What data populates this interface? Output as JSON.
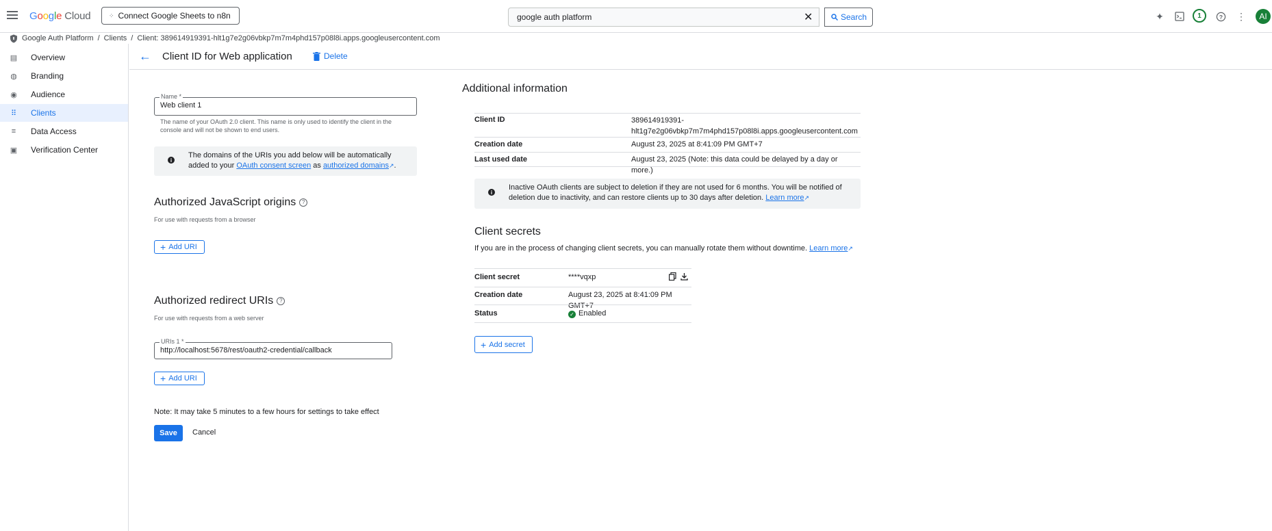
{
  "topbar": {
    "logo_google": "Google",
    "logo_cloud": "Cloud",
    "project": "Connect Google Sheets to n8n",
    "search_value": "google auth platform",
    "search_button": "Search",
    "notification_count": "1",
    "avatar_initials": "AI"
  },
  "breadcrumb": {
    "items": [
      "Google Auth Platform",
      "Clients",
      "Client: 389614919391-hlt1g7e2g06vbkp7m7m4phd157p08l8i.apps.googleusercontent.com"
    ],
    "separator": "/"
  },
  "sidebar": {
    "items": [
      {
        "label": "Overview"
      },
      {
        "label": "Branding"
      },
      {
        "label": "Audience"
      },
      {
        "label": "Clients"
      },
      {
        "label": "Data Access"
      },
      {
        "label": "Verification Center"
      }
    ]
  },
  "header": {
    "title": "Client ID for Web application",
    "delete_label": "Delete"
  },
  "form": {
    "name_label": "Name *",
    "name_value": "Web client 1",
    "name_hint": "The name of your OAuth 2.0 client. This name is only used to identify the client in the console and will not be shown to end users.",
    "info_text_before": "The domains of the URIs you add below will be automatically added to your",
    "info_link1": "OAuth consent screen",
    "info_mid": "as",
    "info_link2": "authorized domains",
    "info_end": ".",
    "js_title": "Authorized JavaScript origins",
    "js_sub": "For use with requests from a browser",
    "add_uri": "Add URI",
    "redirect_title": "Authorized redirect URIs",
    "redirect_sub": "For use with requests from a web server",
    "uri_label": "URIs 1 *",
    "uri_value": "http://localhost:5678/rest/oauth2-credential/callback",
    "note": "Note: It may take 5 minutes to a few hours for settings to take effect",
    "save": "Save",
    "cancel": "Cancel"
  },
  "additional": {
    "title": "Additional information",
    "rows": [
      {
        "key": "Client ID",
        "value_line1": "389614919391-",
        "value_line2": "hlt1g7e2g06vbkp7m7m4phd157p08l8i.apps.googleusercontent.com"
      },
      {
        "key": "Creation date",
        "value": "August 23, 2025 at 8:41:09 PM GMT+7"
      },
      {
        "key": "Last used date",
        "value": "August 23, 2025 (Note: this data could be delayed by a day or more.)"
      }
    ],
    "inactive_text": "Inactive OAuth clients are subject to deletion if they are not used for 6 months. You will be notified of deletion due to inactivity, and can restore clients up to 30 days after deletion.",
    "learn_more": "Learn more"
  },
  "secrets": {
    "title": "Client secrets",
    "desc": "If you are in the process of changing client secrets, you can manually rotate them without downtime.",
    "learn_more": "Learn more",
    "rows": [
      {
        "key": "Client secret",
        "value": "****vqxp"
      },
      {
        "key": "Creation date",
        "value": "August 23, 2025 at 8:41:09 PM GMT+7"
      },
      {
        "key": "Status",
        "value": "Enabled"
      }
    ],
    "add_secret": "Add secret"
  }
}
